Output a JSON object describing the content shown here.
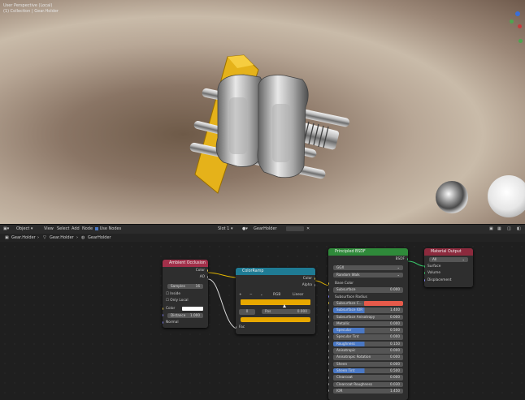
{
  "viewport": {
    "overlay_title": "User Perspective (Local)",
    "overlay_sub": "(1) Collection | Gear.Holder"
  },
  "header": {
    "editor": "Object",
    "menus": [
      "View",
      "Select",
      "Add",
      "Node"
    ],
    "use_nodes": "Use Nodes",
    "slot": "Slot 1",
    "material": "GearHolder"
  },
  "breadcrumb": [
    "Gear.Holder",
    "Gear.Holder",
    "GearHolder"
  ],
  "nodes": {
    "ao": {
      "title": "Ambient Occlusion",
      "out_color": "Color",
      "out_ao": "AO",
      "samples_label": "Samples",
      "samples_value": "16",
      "inside": "Inside",
      "only_local": "Only Local",
      "color": "Color",
      "distance_label": "Distance",
      "distance_value": "1.000",
      "normal": "Normal"
    },
    "ramp": {
      "title": "ColorRamp",
      "out_color": "Color",
      "out_alpha": "Alpha",
      "mode": "RGB",
      "interp": "Linear",
      "index": "0",
      "pos_label": "Pos",
      "pos_value": "0.000",
      "fac": "Fac"
    },
    "bsdf": {
      "title": "Principled BSDF",
      "out_bsdf": "BSDF",
      "dist": "GGX",
      "sss": "Random Walk",
      "rows": [
        {
          "label": "Base Color",
          "val": ""
        },
        {
          "label": "Subsurface",
          "val": "0.000"
        },
        {
          "label": "Subsurface Radius",
          "val": ""
        },
        {
          "label": "Subsurface C...",
          "val": ""
        },
        {
          "label": "Subsurface IOR",
          "val": "1.400"
        },
        {
          "label": "Subsurface Anisotropy",
          "val": "0.000"
        },
        {
          "label": "Metallic",
          "val": "0.000"
        },
        {
          "label": "Specular",
          "val": "0.500"
        },
        {
          "label": "Specular Tint",
          "val": "0.000"
        },
        {
          "label": "Roughness",
          "val": "0.150"
        },
        {
          "label": "Anisotropic",
          "val": "0.000"
        },
        {
          "label": "Anisotropic Rotation",
          "val": "0.000"
        },
        {
          "label": "Sheen",
          "val": "0.000"
        },
        {
          "label": "Sheen Tint",
          "val": "0.500"
        },
        {
          "label": "Clearcoat",
          "val": "0.000"
        },
        {
          "label": "Clearcoat Roughness",
          "val": "0.030"
        },
        {
          "label": "IOR",
          "val": "1.450"
        }
      ]
    },
    "output": {
      "title": "Material Output",
      "target": "All",
      "surface": "Surface",
      "volume": "Volume",
      "displacement": "Displacement"
    }
  },
  "colors": {
    "ao_header": "#a2304a",
    "ramp_header": "#1f7b94",
    "bsdf_header": "#2f8a3a",
    "output_header": "#8c2a3d",
    "ramp_yellow": "#e8a800",
    "subsurface_color": "#e65a4a"
  }
}
